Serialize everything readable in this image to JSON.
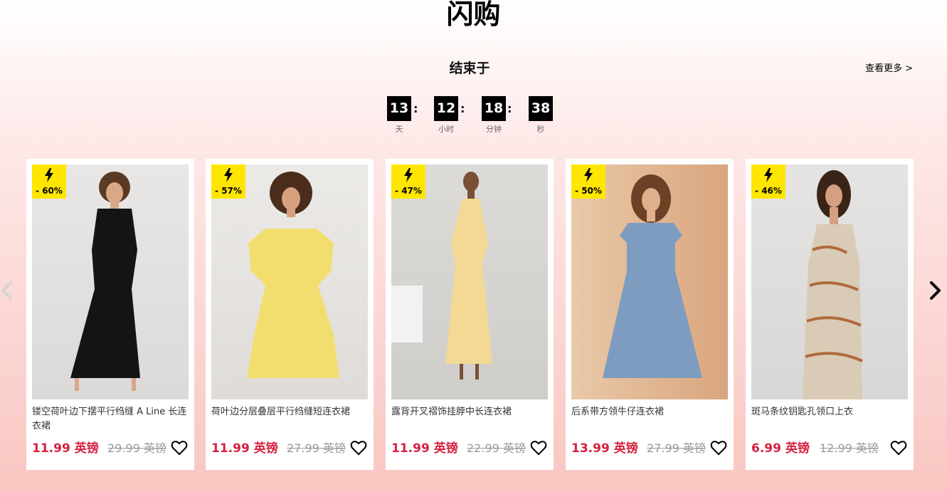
{
  "section": {
    "title": "闪购",
    "ends_label": "结束于",
    "see_more": "查看更多 >"
  },
  "countdown": {
    "days": "13",
    "days_label": "天",
    "hours": "12",
    "hours_label": "小时",
    "minutes": "18",
    "minutes_label": "分钟",
    "seconds": "38",
    "seconds_label": "秒",
    "separator": ":"
  },
  "products": [
    {
      "discount": "- 60%",
      "name": "镂空荷叶边下摆平行绉缝 A Line 长连衣裙",
      "price": "11.99 英镑",
      "old_price": "29.99 英镑",
      "dress_color": "#141414"
    },
    {
      "discount": "- 57%",
      "name": "荷叶边分层叠层平行绉缝短连衣裙",
      "price": "11.99 英镑",
      "old_price": "27.99 英镑",
      "dress_color": "#f2de6e"
    },
    {
      "discount": "- 47%",
      "name": "露背开叉褶饰挂脖中长连衣裙",
      "price": "11.99 英镑",
      "old_price": "22.99 英镑",
      "dress_color": "#f3d994"
    },
    {
      "discount": "- 50%",
      "name": "后系带方领牛仔连衣裙",
      "price": "13.99 英镑",
      "old_price": "27.99 英镑",
      "dress_color": "#7e9cc0"
    },
    {
      "discount": "- 46%",
      "name": "斑马条纹钥匙孔领口上衣",
      "price": "6.99 英镑",
      "old_price": "12.99 英镑",
      "dress_color": "#d9cbb6"
    }
  ]
}
